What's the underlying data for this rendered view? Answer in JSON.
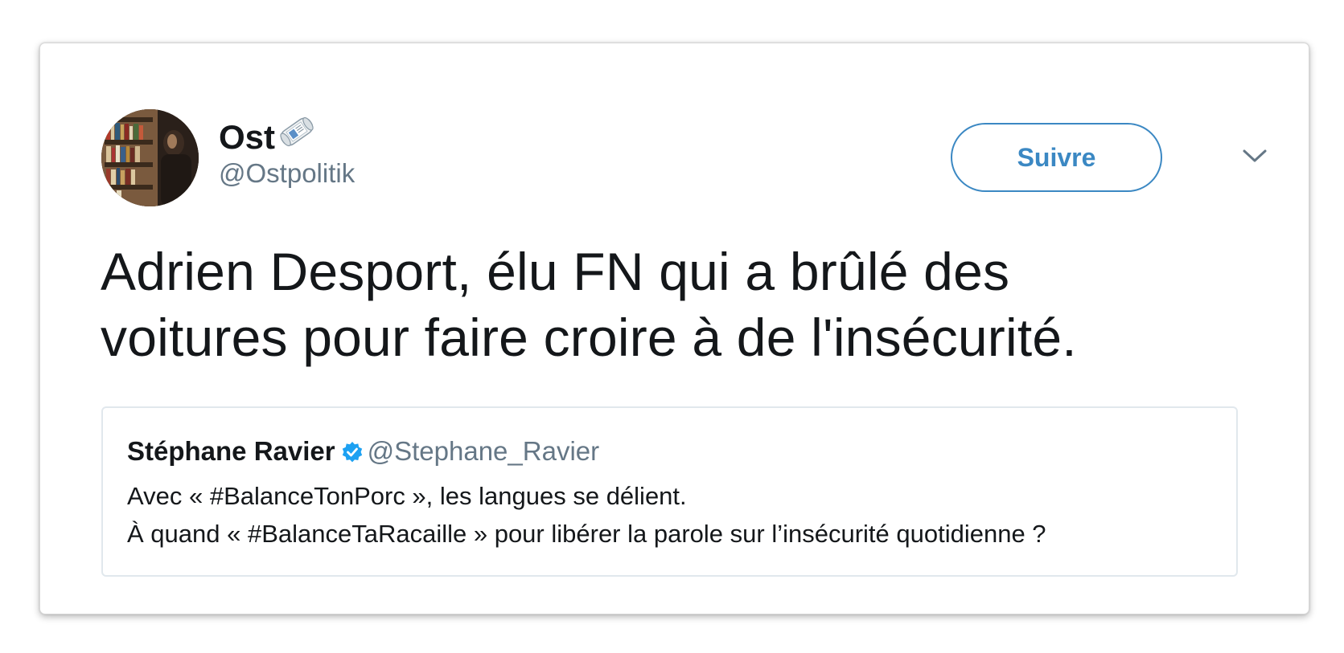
{
  "tweet": {
    "author": {
      "display_name": "Ost",
      "name_emoji_icon": "rolled-newspaper-icon",
      "handle": "@Ostpolitik",
      "avatar_icon": "avatar-bookshelf-photo"
    },
    "follow_label": "Suivre",
    "menu_icon": "chevron-down-icon",
    "text_lines": [
      "Adrien Desport, élu FN qui a brûlé des",
      "voitures pour faire croire à de l'insécurité."
    ],
    "quoted": {
      "display_name": "Stéphane Ravier",
      "verified_icon": "verified-badge-icon",
      "handle": "@Stephane_Ravier",
      "text_lines": [
        "Avec « #BalanceTonPorc », les langues se délient.",
        "À quand « #BalanceTaRacaille » pour libérer la parole sur l’insécurité quotidienne ?"
      ]
    }
  },
  "colors": {
    "accent": "#3b88c3",
    "text": "#14171a",
    "secondary_text": "#657786",
    "verified": "#1da1f2",
    "quote_border": "#e1e8ed"
  }
}
